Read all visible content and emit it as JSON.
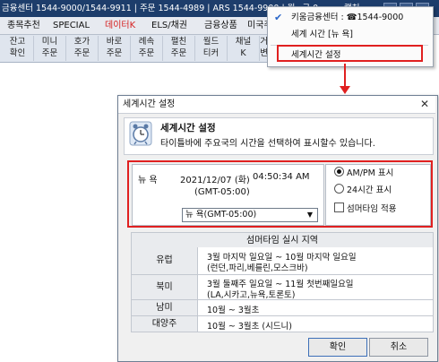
{
  "infobar": {
    "text": "금융센터 1544-9000/1544-9911 | 주문 1544-4989 | ARS 1544-9900 | 월~금 0",
    "right_text": "캡처",
    "bg_color": "#1d3d6b"
  },
  "menubar": {
    "items": [
      "종목추천",
      "SPECIAL",
      "데이터K",
      "ELS/채권",
      "금융상품",
      "미국주식"
    ],
    "highlight_color": "#d61f1f"
  },
  "toolbar": {
    "buttons": [
      {
        "l1": "잔고",
        "l2": "확인"
      },
      {
        "l1": "미니",
        "l2": "주문"
      },
      {
        "l1": "호가",
        "l2": "주문"
      },
      {
        "l1": "바로",
        "l2": "주문"
      },
      {
        "l1": "례속",
        "l2": "주문"
      },
      {
        "l1": "펼친",
        "l2": "주문"
      },
      {
        "l1": "월드",
        "l2": "티커"
      },
      {
        "l1": "채널",
        "l2": "K"
      },
      {
        "l1": "거래",
        "l2": "변동"
      }
    ]
  },
  "dropdown": {
    "items": [
      {
        "label": "키움금융센터 : ☎1544-9000",
        "checked": true
      },
      {
        "label": "세계 시간 [뉴   욕]",
        "checked": false
      },
      {
        "label": "세계시간 설정",
        "checked": false
      }
    ]
  },
  "dialog": {
    "title": "세계시간 설정",
    "close": "✕",
    "header_title": "세계시간 설정",
    "header_desc": "타이틀바에 주요국의 시간을 선택하여 표시할수 있습니다.",
    "city": "뉴   욕",
    "date": "2021/12/07 (화)",
    "time": "04:50:34 AM",
    "gmt": "(GMT-05:00)",
    "select_value": "뉴   욕(GMT-05:00)",
    "options": {
      "ampm": "AM/PM 표시",
      "h24": "24시간 표시",
      "dst": "섬머타임 적용",
      "selected": "ampm",
      "dst_checked": false
    },
    "dst_table": {
      "header": "섬머타임 실시 지역",
      "rows": [
        {
          "region": "유럽",
          "line1": "3월 마지막 일요일 ~ 10월 마지막 일요일",
          "line2": "(런던,파리,베를린,모스크바)"
        },
        {
          "region": "북미",
          "line1": "3월 둘째주 일요일 ~ 11월 첫번째일요일",
          "line2": "(LA,시카고,뉴욕,토론토)"
        },
        {
          "region": "남미",
          "line1": "10월 ~ 3월초",
          "line2": ""
        },
        {
          "region": "대양주",
          "line1": "10월 ~ 3월초 (시드니)",
          "line2": ""
        }
      ]
    },
    "ok": "확인",
    "cancel": "취소"
  },
  "colors": {
    "annotation": "#e02020",
    "accent": "#2a66c9"
  }
}
